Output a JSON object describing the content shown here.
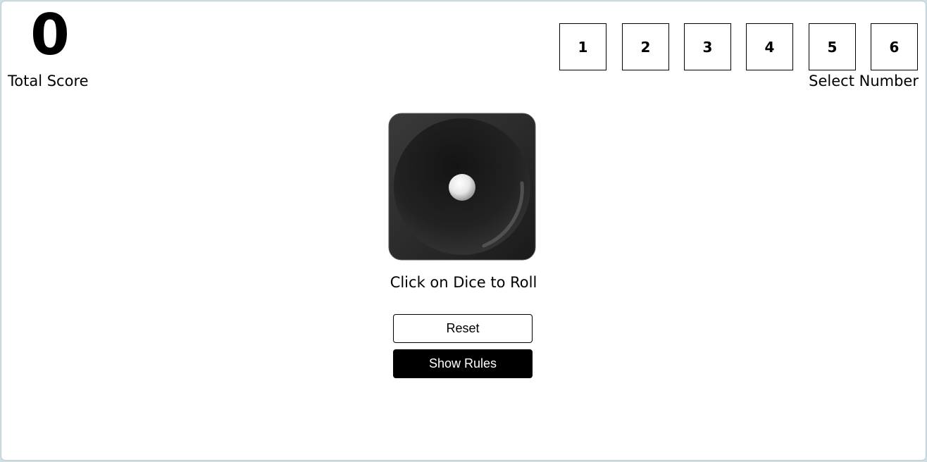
{
  "score": {
    "value": "0",
    "label": "Total Score"
  },
  "number_selector": {
    "options": [
      "1",
      "2",
      "3",
      "4",
      "5",
      "6"
    ],
    "label": "Select Number"
  },
  "dice": {
    "face_value": 1,
    "icon": "dice-one-icon",
    "hint": "Click on Dice to Roll"
  },
  "buttons": {
    "reset_label": "Reset",
    "rules_label": "Show Rules"
  },
  "colors": {
    "dice_body": "#2a2a2a",
    "primary": "#000000",
    "background": "#ffffff"
  }
}
